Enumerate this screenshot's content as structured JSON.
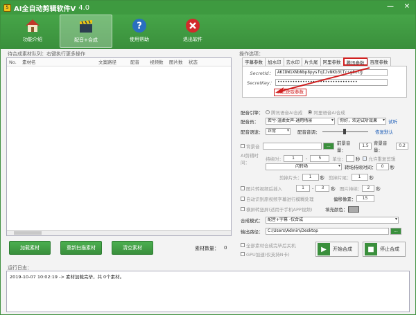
{
  "titlebar": {
    "icon_text": "5",
    "title": "AI全自动剪辑软件V",
    "version": "4.0"
  },
  "toolbar": {
    "items": [
      {
        "label": "功能介绍",
        "icon": "home-icon"
      },
      {
        "label": "配音+合成",
        "icon": "clapperboard-icon"
      },
      {
        "label": "使用帮助",
        "icon": "help-icon"
      },
      {
        "label": "退出软件",
        "icon": "exit-icon"
      }
    ]
  },
  "left": {
    "group_label": "待合成素材队列：右键执行更多操作",
    "columns": [
      "No.",
      "素材名",
      "文案路径",
      "配音",
      "视频数",
      "图片数",
      "状态"
    ],
    "buttons": [
      "加载素材",
      "重新扫描素材",
      "清空素材"
    ],
    "count_label": "素材数量：",
    "count_value": "0"
  },
  "right": {
    "group_label": "操作选项：",
    "tabs": [
      "字幕参数",
      "加水印",
      "去水印",
      "片头尾",
      "阿里参数",
      "腾讯参数",
      "百度参数"
    ],
    "selected_tab": "腾讯参数",
    "secret_id_label": "SecretId：",
    "secret_id": "AKIDW1XNbNbp8pysfqIJvNKb3tTcsg5olg",
    "secret_key_label": "SecretKey：",
    "secret_key": "••••••••••••••••••••••••••••••••",
    "link": "点此获取参数",
    "engine_label": "配音引擎：",
    "engine_opt1": "腾讯语音AI合成",
    "engine_opt2": "阿里语音AI合成",
    "voice_label": "配音员：",
    "voice_value": "若兮-温柔女声-通用场景",
    "voice_sample": "你好，欢迎试听效果",
    "audition": "试听",
    "speed_label": "配音语速：",
    "speed_value": "正常",
    "volume_label": "配音音调：",
    "reset": "恢复默认",
    "bgm_label": "背景音",
    "browse": "...",
    "front_vol_label": "前景音量：",
    "front_vol": "1.5",
    "bg_vol_label": "背景音量：",
    "bg_vol": "0.2",
    "ai_label": "AI剪辑时间：",
    "time_label": "持续时：",
    "time_from": "1",
    "time_to": "5",
    "unit": "单位：",
    "sec": "秒",
    "allow_repeat": "允许重复剪辑",
    "transition_value": "闪转场",
    "transition_time_label": "转场持续时间：",
    "transition_time": "0",
    "cut_head_label": "剪掉片头：",
    "cut_head": "1",
    "cut_tail_label": "剪掉片尾：",
    "cut_tail": "1",
    "pic_label": "图片转视频后插入",
    "pic_from": "1",
    "pic_to": "3",
    "pic_dur_label": "图片持续：",
    "pic_dur": "2",
    "auto_sub_label": "自动识别原视频字幕进行模糊处理",
    "offset_label": "偏移像素：",
    "offset": "15",
    "vertical_label": "横屏转竖屏(适用于手机APP视频)",
    "fill_color_label": "填充颜色：",
    "mode_label": "合成模式：",
    "mode_value": "配音+字幕 -仅合成",
    "output_label": "输出路径：",
    "output_path": "C:\\Users\\Admin\\Desktop",
    "shutdown_label": "全部素材合成完毕后关机",
    "gpu_label": "GPU加速(仅支持N卡)",
    "start_button": "开始合成",
    "stop_button": "停止合成"
  },
  "log": {
    "label": "运行日志：",
    "lines": [
      "2019-10-07 10:02:19 -> 素材加载完毕，共 0个素材。"
    ]
  },
  "colors": {
    "accent": "#3e9a40",
    "highlight": "#d02020"
  }
}
